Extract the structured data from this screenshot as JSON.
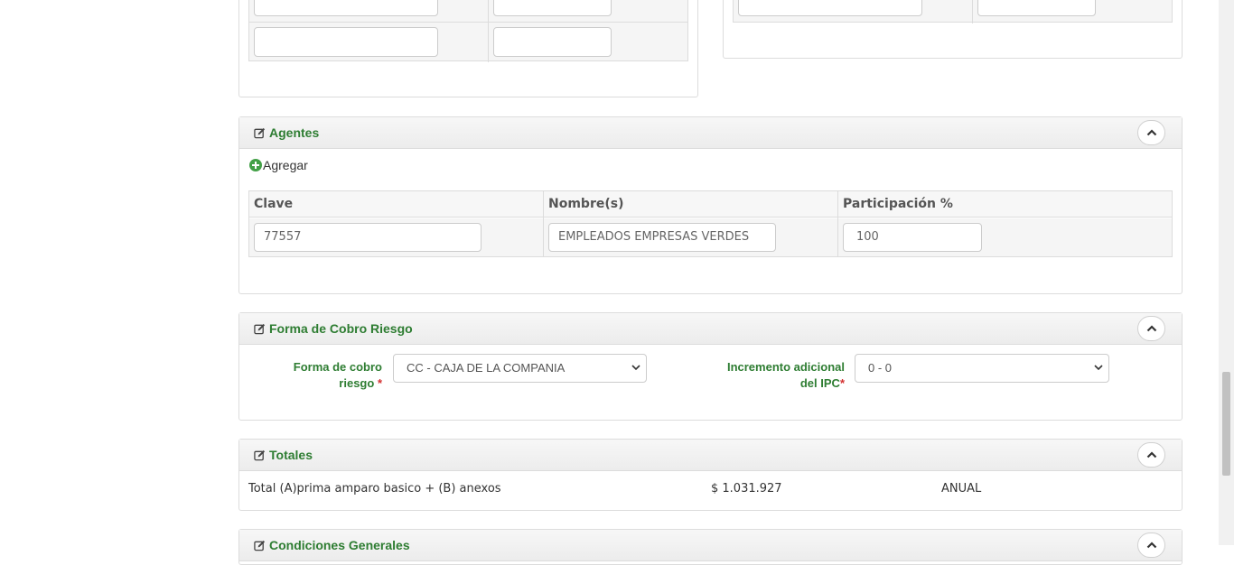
{
  "agentes": {
    "title": "Agentes",
    "add_label": "Agregar",
    "columns": [
      "Clave",
      "Nombre(s)",
      "Participación %"
    ],
    "row": {
      "clave": "77557",
      "nombre": "EMPLEADOS EMPRESAS VERDES",
      "participacion": "100"
    }
  },
  "forma_cobro": {
    "title": "Forma de Cobro Riesgo",
    "cobro_label_line1": "Forma de cobro",
    "cobro_label_line2": "riesgo",
    "cobro_value": "CC - CAJA DE LA COMPANIA",
    "ipc_label_line1": "Incremento adicional",
    "ipc_label_line2": "del IPC",
    "ipc_value": "0 - 0",
    "required_mark": "*"
  },
  "totales": {
    "title": "Totales",
    "label": "Total (A)prima amparo basico + (B) anexos",
    "amount": "$ 1.031.927",
    "period": "ANUAL"
  },
  "condiciones": {
    "title": "Condiciones Generales"
  },
  "colors": {
    "accent_green": "#2e7d32",
    "add_icon_green": "#43a047",
    "required_red": "#d32f2f"
  }
}
